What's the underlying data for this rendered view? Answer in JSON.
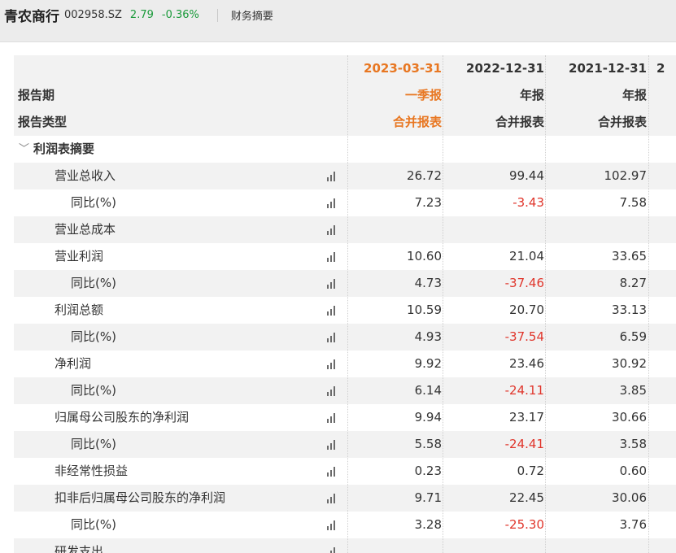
{
  "header": {
    "stock_name": "青农商行",
    "stock_code": "002958.SZ",
    "price": "2.79",
    "change": "-0.36%",
    "tab": "财务摘要"
  },
  "columns": [
    {
      "date": "2023-03-31",
      "report": "一季报",
      "type": "合并报表",
      "highlight": true
    },
    {
      "date": "2022-12-31",
      "report": "年报",
      "type": "合并报表",
      "highlight": false
    },
    {
      "date": "2021-12-31",
      "report": "年报",
      "type": "合并报表",
      "highlight": false
    },
    {
      "date": "2",
      "report": "",
      "type": "",
      "highlight": false
    }
  ],
  "row_labels": {
    "period": "报告期",
    "report_type": "报告类型",
    "section": "利润表摘要"
  },
  "rows": [
    {
      "label": "营业总收入",
      "indent": 1,
      "values": [
        "26.72",
        "99.44",
        "102.97"
      ],
      "neg": [
        false,
        false,
        false
      ]
    },
    {
      "label": "同比(%)",
      "indent": 2,
      "values": [
        "7.23",
        "-3.43",
        "7.58"
      ],
      "neg": [
        false,
        true,
        false
      ]
    },
    {
      "label": "营业总成本",
      "indent": 1,
      "values": [
        "",
        "",
        ""
      ],
      "neg": [
        false,
        false,
        false
      ]
    },
    {
      "label": "营业利润",
      "indent": 1,
      "values": [
        "10.60",
        "21.04",
        "33.65"
      ],
      "neg": [
        false,
        false,
        false
      ]
    },
    {
      "label": "同比(%)",
      "indent": 2,
      "values": [
        "4.73",
        "-37.46",
        "8.27"
      ],
      "neg": [
        false,
        true,
        false
      ]
    },
    {
      "label": "利润总额",
      "indent": 1,
      "values": [
        "10.59",
        "20.70",
        "33.13"
      ],
      "neg": [
        false,
        false,
        false
      ]
    },
    {
      "label": "同比(%)",
      "indent": 2,
      "values": [
        "4.93",
        "-37.54",
        "6.59"
      ],
      "neg": [
        false,
        true,
        false
      ]
    },
    {
      "label": "净利润",
      "indent": 1,
      "values": [
        "9.92",
        "23.46",
        "30.92"
      ],
      "neg": [
        false,
        false,
        false
      ]
    },
    {
      "label": "同比(%)",
      "indent": 2,
      "values": [
        "6.14",
        "-24.11",
        "3.85"
      ],
      "neg": [
        false,
        true,
        false
      ]
    },
    {
      "label": "归属母公司股东的净利润",
      "indent": 1,
      "values": [
        "9.94",
        "23.17",
        "30.66"
      ],
      "neg": [
        false,
        false,
        false
      ]
    },
    {
      "label": "同比(%)",
      "indent": 2,
      "values": [
        "5.58",
        "-24.41",
        "3.58"
      ],
      "neg": [
        false,
        true,
        false
      ]
    },
    {
      "label": "非经常性损益",
      "indent": 1,
      "values": [
        "0.23",
        "0.72",
        "0.60"
      ],
      "neg": [
        false,
        false,
        false
      ]
    },
    {
      "label": "扣非后归属母公司股东的净利润",
      "indent": 1,
      "values": [
        "9.71",
        "22.45",
        "30.06"
      ],
      "neg": [
        false,
        false,
        false
      ]
    },
    {
      "label": "同比(%)",
      "indent": 2,
      "values": [
        "3.28",
        "-25.30",
        "3.76"
      ],
      "neg": [
        false,
        true,
        false
      ]
    },
    {
      "label": "研发支出",
      "indent": 1,
      "values": [
        "",
        "",
        ""
      ],
      "neg": [
        false,
        false,
        false
      ]
    }
  ],
  "colors": {
    "accent": "#e87722",
    "negative": "#e0352b",
    "up_down_green": "#1a9a3a"
  }
}
